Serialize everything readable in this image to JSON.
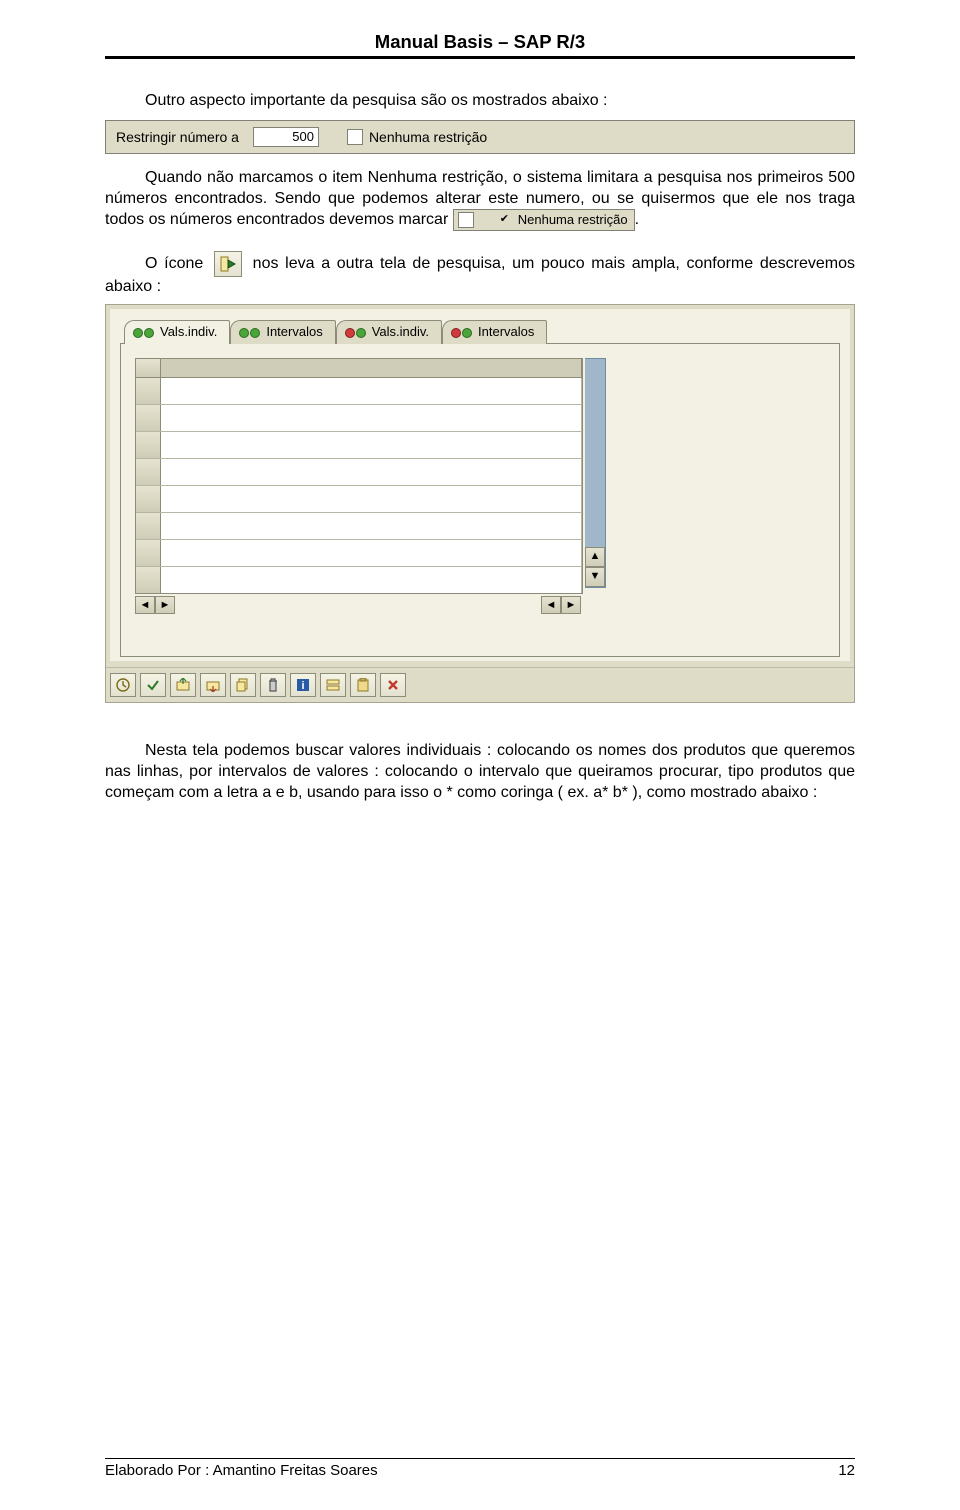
{
  "header": {
    "title": "Manual Basis – SAP R/3"
  },
  "body": {
    "p1": "Outro aspecto importante da pesquisa são os mostrados abaixo :",
    "strip": {
      "label": "Restringir número a",
      "value": "500",
      "checkbox_label": "Nenhuma restrição"
    },
    "p2a": "Quando não marcamos o item Nenhuma restrição, o sistema limitara a pesquisa nos primeiros 500 números encontrados.  Sendo que podemos alterar este numero, ou se quisermos que ele nos traga todos os  números encontrados devemos marcar ",
    "p2b_chk_label": "Nenhuma restrição",
    "p2c": ".",
    "p3a": "O ícone ",
    "p3b": " nos leva a outra tela de pesquisa, um pouco mais ampla, conforme descrevemos abaixo :",
    "tabs": {
      "t1": "Vals.indiv.",
      "t2": "Intervalos",
      "t3": "Vals.indiv.",
      "t4": "Intervalos"
    },
    "p4": "Nesta tela podemos buscar valores individuais : colocando os nomes dos produtos que queremos nas linhas, por intervalos de valores : colocando o intervalo que queiramos procurar, tipo produtos que começam com a letra a e b, usando para isso o * como coringa ( ex. a* b* ), como mostrado abaixo :"
  },
  "footer": {
    "left": "Elaborado Por : Amantino Freitas Soares",
    "right": "12"
  }
}
